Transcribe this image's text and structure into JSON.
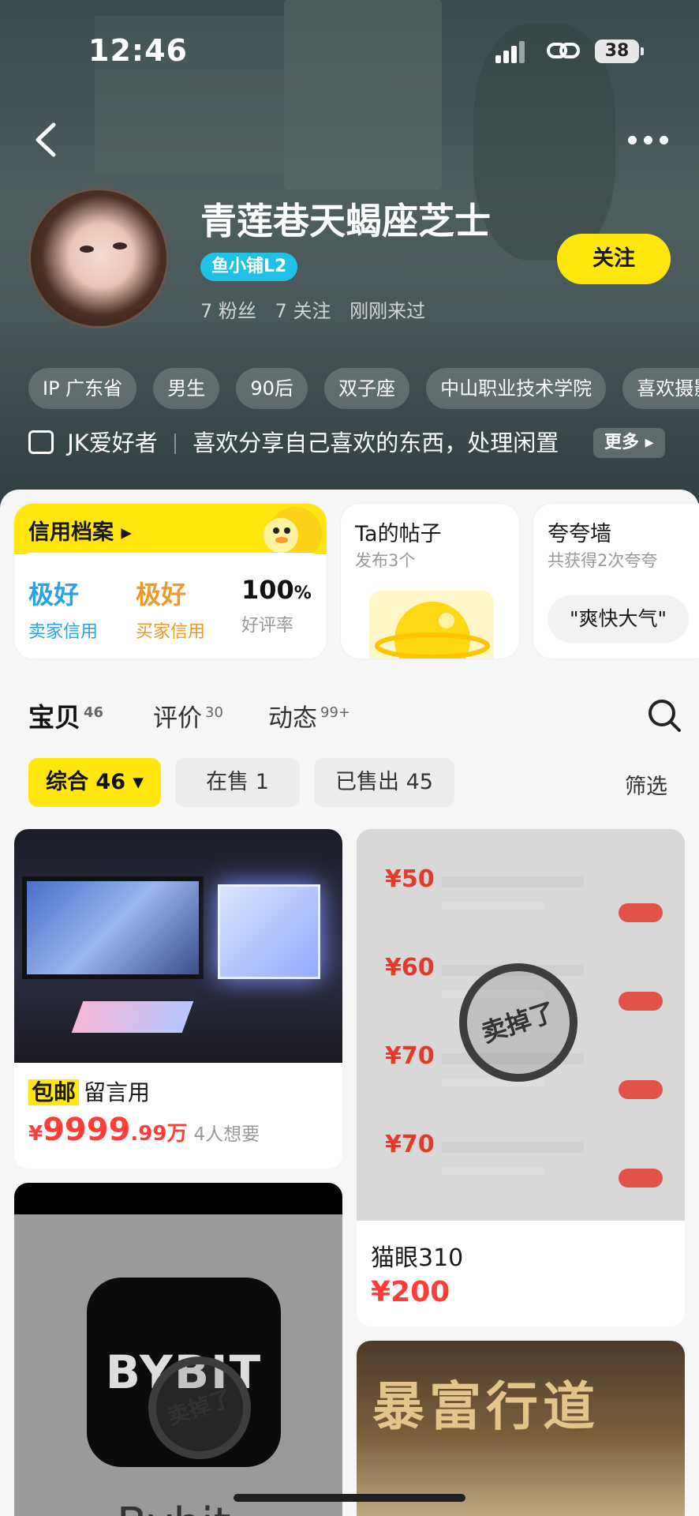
{
  "status_bar": {
    "time": "12:46",
    "battery": "38"
  },
  "profile": {
    "name": "青莲巷天蝎座芝士",
    "level_badge": "鱼小铺L2",
    "fans": "7 粉丝",
    "following": "7 关注",
    "last_seen": "刚刚来过",
    "follow_label": "关注"
  },
  "tags": [
    "IP 广东省",
    "男生",
    "90后",
    "双子座",
    "中山职业技术学院",
    "喜欢摄影"
  ],
  "bio": {
    "prefix": "JK爱好者",
    "text": "喜欢分享自己喜欢的东西，处理闲置",
    "more_label": "更多"
  },
  "credit": {
    "title": "信用档案",
    "seller_value": "极好",
    "seller_label": "卖家信用",
    "buyer_value": "极好",
    "buyer_label": "买家信用",
    "rating_value": "100",
    "rating_unit": "%",
    "rating_label": "好评率",
    "colors": {
      "seller": "#29a3e6",
      "buyer": "#f0982a"
    }
  },
  "posts_card": {
    "title": "Ta的帖子",
    "subtitle": "发布3个"
  },
  "praise_card": {
    "title": "夸夸墙",
    "subtitle": "共获得2次夸夸",
    "pill": "\"爽快大气\""
  },
  "tabs": [
    {
      "label": "宝贝",
      "count": "46"
    },
    {
      "label": "评价",
      "count": "30"
    },
    {
      "label": "动态",
      "count": "99+"
    }
  ],
  "filters": {
    "all": "综合 46",
    "on_sale": "在售 1",
    "sold": "已售出 45",
    "filter_label": "筛选"
  },
  "products": {
    "p1": {
      "ship_tag": "包邮",
      "title": "留言用",
      "price_symbol": "¥",
      "price_main": "9999",
      "price_tail": ".99万",
      "wants": "4人想要"
    },
    "p2": {
      "title": "猫眼310",
      "price": "¥200",
      "coupons": [
        "¥50",
        "¥60",
        "¥70",
        "¥70"
      ],
      "stamp": "卖掉了"
    },
    "p3": {
      "logo": "BYBIT",
      "name": "Bybit",
      "stamp": "卖掉了"
    },
    "p4": {
      "art_text": "暴富行道"
    }
  },
  "colors": {
    "accent": "#ffe60f",
    "price": "#ff3c36"
  }
}
